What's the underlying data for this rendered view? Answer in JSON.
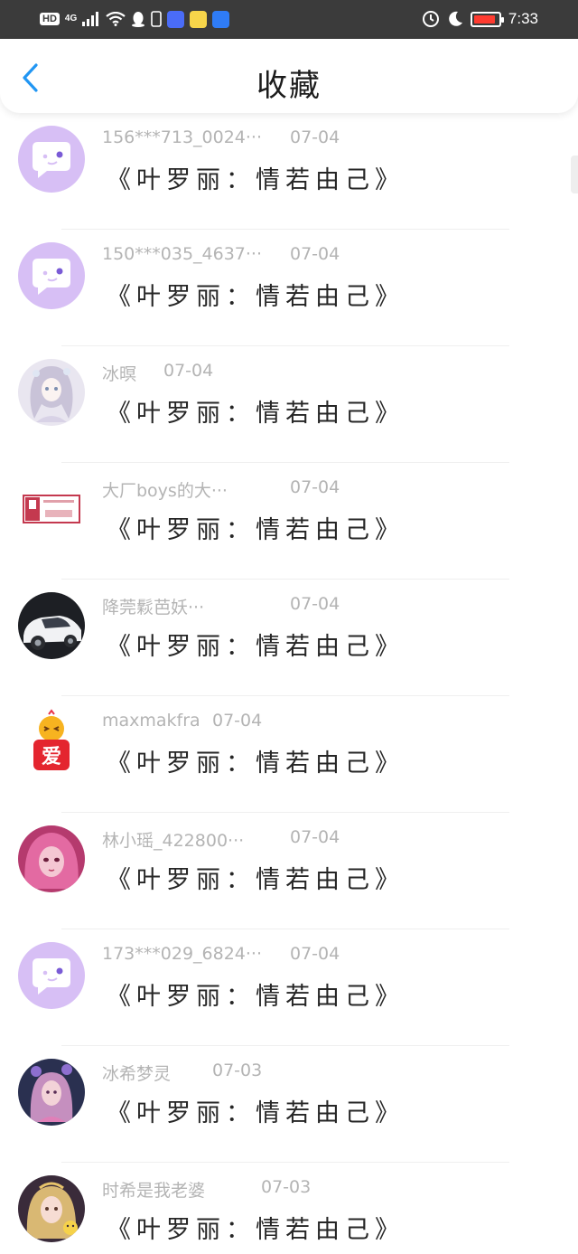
{
  "status_bar": {
    "network_badge": "HD",
    "network_type": "4G",
    "time": "7:33",
    "battery_level": 0.9
  },
  "header": {
    "title": "收藏",
    "back_icon": "chevron-left-icon"
  },
  "items": [
    {
      "user": "156***713_0024···",
      "date": "07-04",
      "work": "《叶罗丽：情若由己》",
      "avatar": "chat-bubble"
    },
    {
      "user": "150***035_4637···",
      "date": "07-04",
      "work": "《叶罗丽：情若由己》",
      "avatar": "chat-bubble"
    },
    {
      "user": "冰暝",
      "date": "07-04",
      "work": "《叶罗丽：情若由己》",
      "avatar": "anime-white"
    },
    {
      "user": "大厂boys的大···",
      "date": "07-04",
      "work": "《叶罗丽：情若由己》",
      "avatar": "logo-red"
    },
    {
      "user": "降莞鬏芭妖···",
      "date": "07-04",
      "work": "《叶罗丽：情若由己》",
      "avatar": "car"
    },
    {
      "user": "maxmakfra",
      "date": "07-04",
      "work": "《叶罗丽：情若由己》",
      "avatar": "love-sticker"
    },
    {
      "user": "林小瑶_422800···",
      "date": "07-04",
      "work": "《叶罗丽：情若由己》",
      "avatar": "doll-pink"
    },
    {
      "user": "173***029_6824···",
      "date": "07-04",
      "work": "《叶罗丽：情若由己》",
      "avatar": "chat-bubble"
    },
    {
      "user": "冰希梦灵",
      "date": "07-03",
      "work": "《叶罗丽：情若由己》",
      "avatar": "doll-dark"
    },
    {
      "user": "时希是我老婆",
      "date": "07-03",
      "work": "《叶罗丽：情若由己》",
      "avatar": "doll-gold"
    }
  ],
  "colors": {
    "status_bar": "#3b3b3b",
    "accent_blue": "#2196f3",
    "avatar_lilac": "#d7bff5",
    "meta_gray": "#b4b4b4"
  }
}
